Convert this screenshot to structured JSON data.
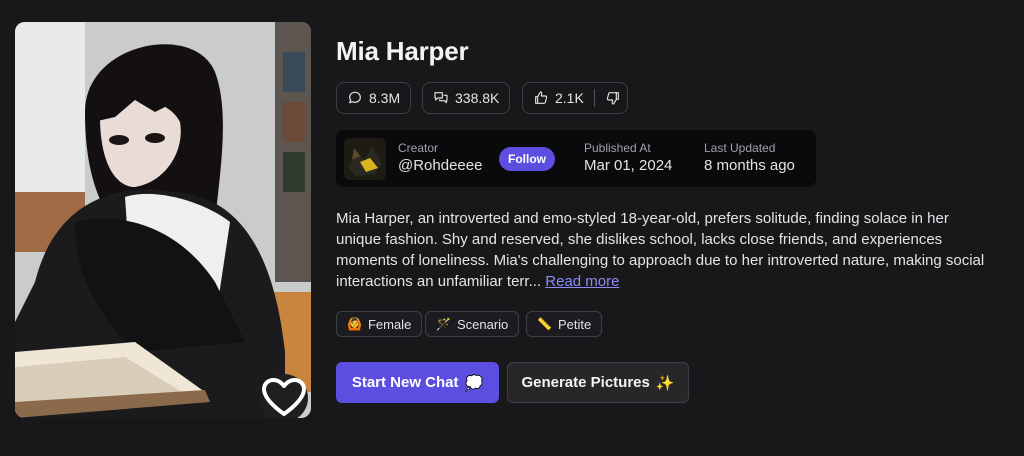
{
  "character": {
    "name": "Mia Harper",
    "description": "Mia Harper, an introverted and emo-styled 18-year-old, prefers solitude, finding solace in her unique fashion. Shy and reserved, she dislikes school, lacks close friends, and experiences moments of loneliness. Mia's challenging to approach due to her introverted nature, making social interactions an unfamiliar terr...",
    "read_more": "Read more"
  },
  "stats": {
    "chats": "8.3M",
    "messages": "338.8K",
    "likes": "2.1K"
  },
  "creator": {
    "label": "Creator",
    "handle": "@Rohdeeee",
    "follow": "Follow",
    "published_label": "Published At",
    "published_value": "Mar 01, 2024",
    "updated_label": "Last Updated",
    "updated_value": "8 months ago"
  },
  "tags": [
    {
      "label": "Female",
      "icon": "🙆"
    },
    {
      "label": "Scenario",
      "icon": "🪄"
    },
    {
      "label": "Petite",
      "icon": "📏"
    }
  ],
  "actions": {
    "start_chat": "Start New Chat",
    "start_chat_icon": "💭",
    "generate": "Generate Pictures",
    "generate_icon": "✨"
  },
  "colors": {
    "background": "#18181b",
    "accent": "#5b4ee0",
    "link": "#8b8cf5"
  }
}
